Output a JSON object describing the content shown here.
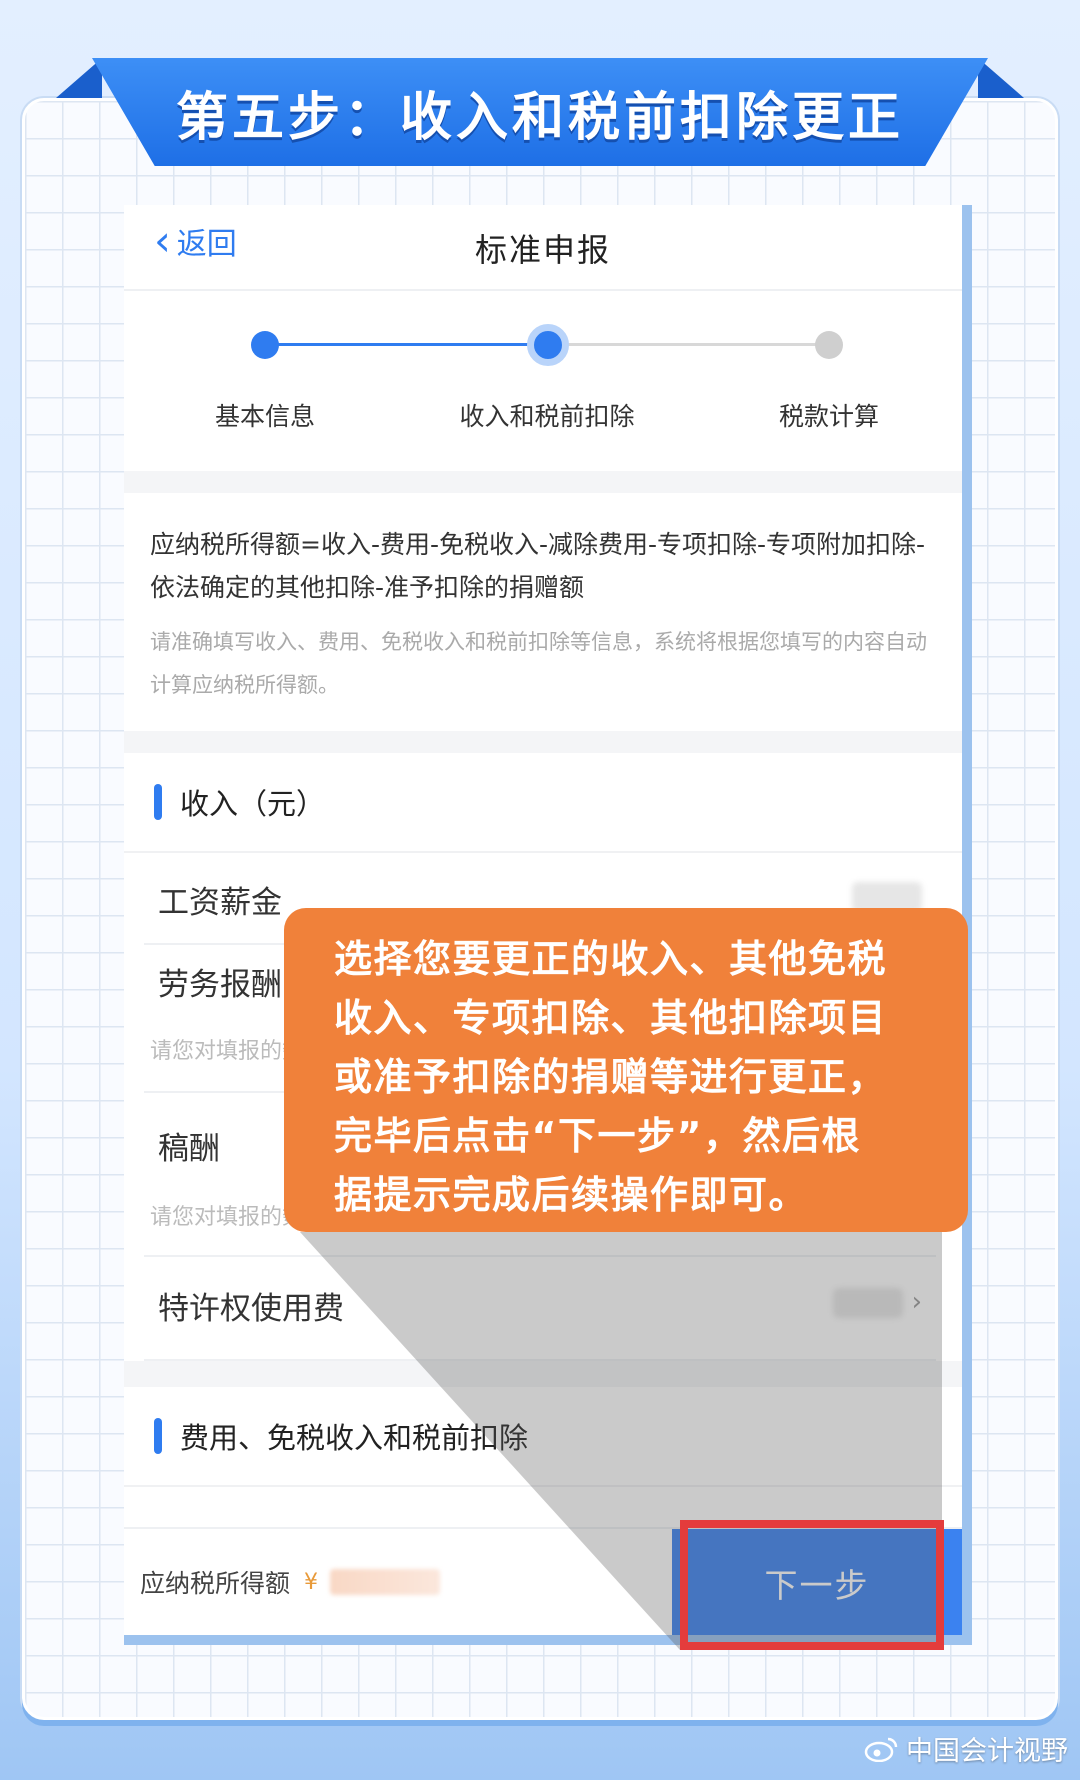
{
  "banner": {
    "title": "第五步：收入和税前扣除更正"
  },
  "nav": {
    "back_label": "返回",
    "title": "标准申报"
  },
  "steps": [
    {
      "label": "基本信息",
      "state": "done"
    },
    {
      "label": "收入和税前扣除",
      "state": "current"
    },
    {
      "label": "税款计算",
      "state": "pending"
    }
  ],
  "formula": {
    "main": "应纳税所得额=收入-费用-免税收入-减除费用-专项扣除-专项附加扣除-依法确定的其他扣除-准予扣除的捐赠额",
    "note": "请准确填写收入、费用、免税收入和税前扣除等信息，系统将根据您填写的内容自动计算应纳税所得额。"
  },
  "income_section": {
    "title": "收入（元）",
    "rows": [
      {
        "label": "工资薪金",
        "hint": ""
      },
      {
        "label": "劳务报酬",
        "hint": "请您对填报的数据认真核实"
      },
      {
        "label": "稿酬",
        "hint": "请您对填报的数据认真核实"
      },
      {
        "label": "特许权使用费",
        "hint": ""
      }
    ]
  },
  "deduction_section": {
    "title": "费用、免税收入和税前扣除"
  },
  "footer": {
    "label": "应纳税所得额",
    "currency": "¥",
    "next_label": "下一步"
  },
  "callout": {
    "lines": [
      "选择您要更正的收入、其他免税",
      "收入、专项扣除、其他扣除项目",
      "或准予扣除的捐赠等进行更正，",
      "完毕后点击“下一步”，然后根",
      "据提示完成后续操作即可。"
    ]
  },
  "watermark": {
    "text": "中国会计视野",
    "icon": "weibo-icon"
  },
  "colors": {
    "primary": "#2f7cf0",
    "callout": "#f0813a",
    "highlight": "#e43c3c",
    "banner": "#1e6fe6"
  }
}
